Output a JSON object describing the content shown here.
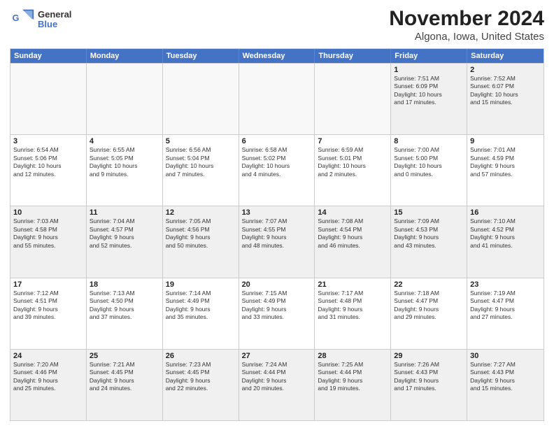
{
  "header": {
    "logo_line1": "General",
    "logo_line2": "Blue",
    "title": "November 2024",
    "subtitle": "Algona, Iowa, United States"
  },
  "days_of_week": [
    "Sunday",
    "Monday",
    "Tuesday",
    "Wednesday",
    "Thursday",
    "Friday",
    "Saturday"
  ],
  "weeks": [
    [
      {
        "day": "",
        "empty": true
      },
      {
        "day": "",
        "empty": true
      },
      {
        "day": "",
        "empty": true
      },
      {
        "day": "",
        "empty": true
      },
      {
        "day": "",
        "empty": true
      },
      {
        "day": "1",
        "info": "Sunrise: 7:51 AM\nSunset: 6:09 PM\nDaylight: 10 hours\nand 17 minutes."
      },
      {
        "day": "2",
        "info": "Sunrise: 7:52 AM\nSunset: 6:07 PM\nDaylight: 10 hours\nand 15 minutes."
      }
    ],
    [
      {
        "day": "3",
        "info": "Sunrise: 6:54 AM\nSunset: 5:06 PM\nDaylight: 10 hours\nand 12 minutes."
      },
      {
        "day": "4",
        "info": "Sunrise: 6:55 AM\nSunset: 5:05 PM\nDaylight: 10 hours\nand 9 minutes."
      },
      {
        "day": "5",
        "info": "Sunrise: 6:56 AM\nSunset: 5:04 PM\nDaylight: 10 hours\nand 7 minutes."
      },
      {
        "day": "6",
        "info": "Sunrise: 6:58 AM\nSunset: 5:02 PM\nDaylight: 10 hours\nand 4 minutes."
      },
      {
        "day": "7",
        "info": "Sunrise: 6:59 AM\nSunset: 5:01 PM\nDaylight: 10 hours\nand 2 minutes."
      },
      {
        "day": "8",
        "info": "Sunrise: 7:00 AM\nSunset: 5:00 PM\nDaylight: 10 hours\nand 0 minutes."
      },
      {
        "day": "9",
        "info": "Sunrise: 7:01 AM\nSunset: 4:59 PM\nDaylight: 9 hours\nand 57 minutes."
      }
    ],
    [
      {
        "day": "10",
        "info": "Sunrise: 7:03 AM\nSunset: 4:58 PM\nDaylight: 9 hours\nand 55 minutes."
      },
      {
        "day": "11",
        "info": "Sunrise: 7:04 AM\nSunset: 4:57 PM\nDaylight: 9 hours\nand 52 minutes."
      },
      {
        "day": "12",
        "info": "Sunrise: 7:05 AM\nSunset: 4:56 PM\nDaylight: 9 hours\nand 50 minutes."
      },
      {
        "day": "13",
        "info": "Sunrise: 7:07 AM\nSunset: 4:55 PM\nDaylight: 9 hours\nand 48 minutes."
      },
      {
        "day": "14",
        "info": "Sunrise: 7:08 AM\nSunset: 4:54 PM\nDaylight: 9 hours\nand 46 minutes."
      },
      {
        "day": "15",
        "info": "Sunrise: 7:09 AM\nSunset: 4:53 PM\nDaylight: 9 hours\nand 43 minutes."
      },
      {
        "day": "16",
        "info": "Sunrise: 7:10 AM\nSunset: 4:52 PM\nDaylight: 9 hours\nand 41 minutes."
      }
    ],
    [
      {
        "day": "17",
        "info": "Sunrise: 7:12 AM\nSunset: 4:51 PM\nDaylight: 9 hours\nand 39 minutes."
      },
      {
        "day": "18",
        "info": "Sunrise: 7:13 AM\nSunset: 4:50 PM\nDaylight: 9 hours\nand 37 minutes."
      },
      {
        "day": "19",
        "info": "Sunrise: 7:14 AM\nSunset: 4:49 PM\nDaylight: 9 hours\nand 35 minutes."
      },
      {
        "day": "20",
        "info": "Sunrise: 7:15 AM\nSunset: 4:49 PM\nDaylight: 9 hours\nand 33 minutes."
      },
      {
        "day": "21",
        "info": "Sunrise: 7:17 AM\nSunset: 4:48 PM\nDaylight: 9 hours\nand 31 minutes."
      },
      {
        "day": "22",
        "info": "Sunrise: 7:18 AM\nSunset: 4:47 PM\nDaylight: 9 hours\nand 29 minutes."
      },
      {
        "day": "23",
        "info": "Sunrise: 7:19 AM\nSunset: 4:47 PM\nDaylight: 9 hours\nand 27 minutes."
      }
    ],
    [
      {
        "day": "24",
        "info": "Sunrise: 7:20 AM\nSunset: 4:46 PM\nDaylight: 9 hours\nand 25 minutes."
      },
      {
        "day": "25",
        "info": "Sunrise: 7:21 AM\nSunset: 4:45 PM\nDaylight: 9 hours\nand 24 minutes."
      },
      {
        "day": "26",
        "info": "Sunrise: 7:23 AM\nSunset: 4:45 PM\nDaylight: 9 hours\nand 22 minutes."
      },
      {
        "day": "27",
        "info": "Sunrise: 7:24 AM\nSunset: 4:44 PM\nDaylight: 9 hours\nand 20 minutes."
      },
      {
        "day": "28",
        "info": "Sunrise: 7:25 AM\nSunset: 4:44 PM\nDaylight: 9 hours\nand 19 minutes."
      },
      {
        "day": "29",
        "info": "Sunrise: 7:26 AM\nSunset: 4:43 PM\nDaylight: 9 hours\nand 17 minutes."
      },
      {
        "day": "30",
        "info": "Sunrise: 7:27 AM\nSunset: 4:43 PM\nDaylight: 9 hours\nand 15 minutes."
      }
    ]
  ]
}
